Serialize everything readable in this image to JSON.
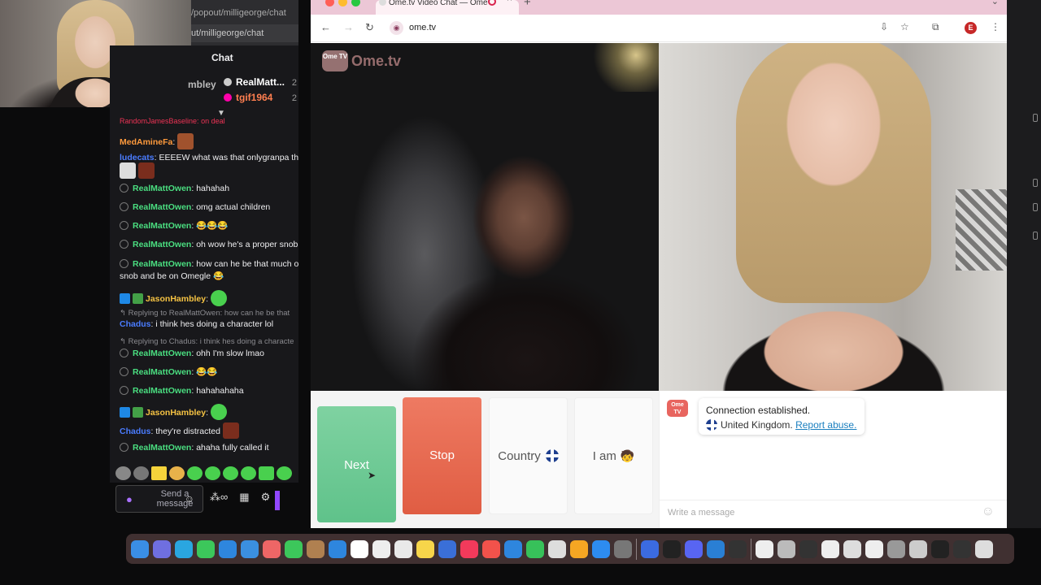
{
  "stream": {
    "url_partial": "/popout/milligeorge/chat",
    "url_field": "ut/milligeorge/chat"
  },
  "twitch_chat": {
    "title": "Chat",
    "left_name": "mbley",
    "gifts": [
      {
        "name": "RealMatt...",
        "num": "2",
        "color": "#ffffff"
      },
      {
        "name": "tgif1964",
        "num": "2",
        "color": "#ff7f50"
      }
    ],
    "messages": [
      {
        "user": "MedAmineFa",
        "color": "#ff9a3c",
        "text": ""
      },
      {
        "user": "ludecats",
        "color": "#4a7cff",
        "text": "EEEEW what was that onlygranpa th"
      },
      {
        "user": "RealMattOwen",
        "color": "#4ade80",
        "text": "hahahah"
      },
      {
        "user": "RealMattOwen",
        "color": "#4ade80",
        "text": "omg actual children"
      },
      {
        "user": "RealMattOwen",
        "color": "#4ade80",
        "text": "😂😂😂"
      },
      {
        "user": "RealMattOwen",
        "color": "#4ade80",
        "text": "oh wow he's a proper snob"
      },
      {
        "user": "RealMattOwen",
        "color": "#4ade80",
        "text": "how can he be that much o"
      },
      {
        "user": "",
        "color": "#efeff1",
        "text": "snob and be on Omegle 😂"
      },
      {
        "user": "JasonHambley",
        "color": "#f6c343",
        "text": ""
      },
      {
        "user": "Chadus",
        "color": "#4a7cff",
        "text": "i think hes doing a character lol"
      },
      {
        "user": "RealMattOwen",
        "color": "#4ade80",
        "text": "ohh I'm slow lmao"
      },
      {
        "user": "RealMattOwen",
        "color": "#4ade80",
        "text": "😂😂"
      },
      {
        "user": "RealMattOwen",
        "color": "#4ade80",
        "text": "hahahahaha"
      },
      {
        "user": "JasonHambley",
        "color": "#f6c343",
        "text": ""
      },
      {
        "user": "Chadus",
        "color": "#4a7cff",
        "text": "they're distracted"
      },
      {
        "user": "RealMattOwen",
        "color": "#4ade80",
        "text": "ahaha fully called it"
      }
    ],
    "replies": [
      "Replying to RealMattOwen: how can he be that",
      "Replying to Chadus: i think hes doing a characte"
    ],
    "input_placeholder": "Send a message",
    "top_cut": "on deal"
  },
  "browser": {
    "tab_title": "Ome.tv Video Chat — Ome",
    "address": "ome.tv",
    "profile_initial": "E"
  },
  "ometv": {
    "logo_badge": "Ome TV",
    "logo_word": "Ome.tv",
    "buttons": {
      "next": "Next",
      "stop": "Stop",
      "country": "Country",
      "iam": "I am"
    },
    "status_line1": "Connection established.",
    "status_country": "United Kingdom.",
    "report": "Report abuse.",
    "message_placeholder": "Write a message"
  },
  "colors": {
    "next": "#6cc894",
    "stop": "#e56a4f",
    "twitch_bg": "#18181b",
    "tab_strip": "#ecc7d6"
  }
}
